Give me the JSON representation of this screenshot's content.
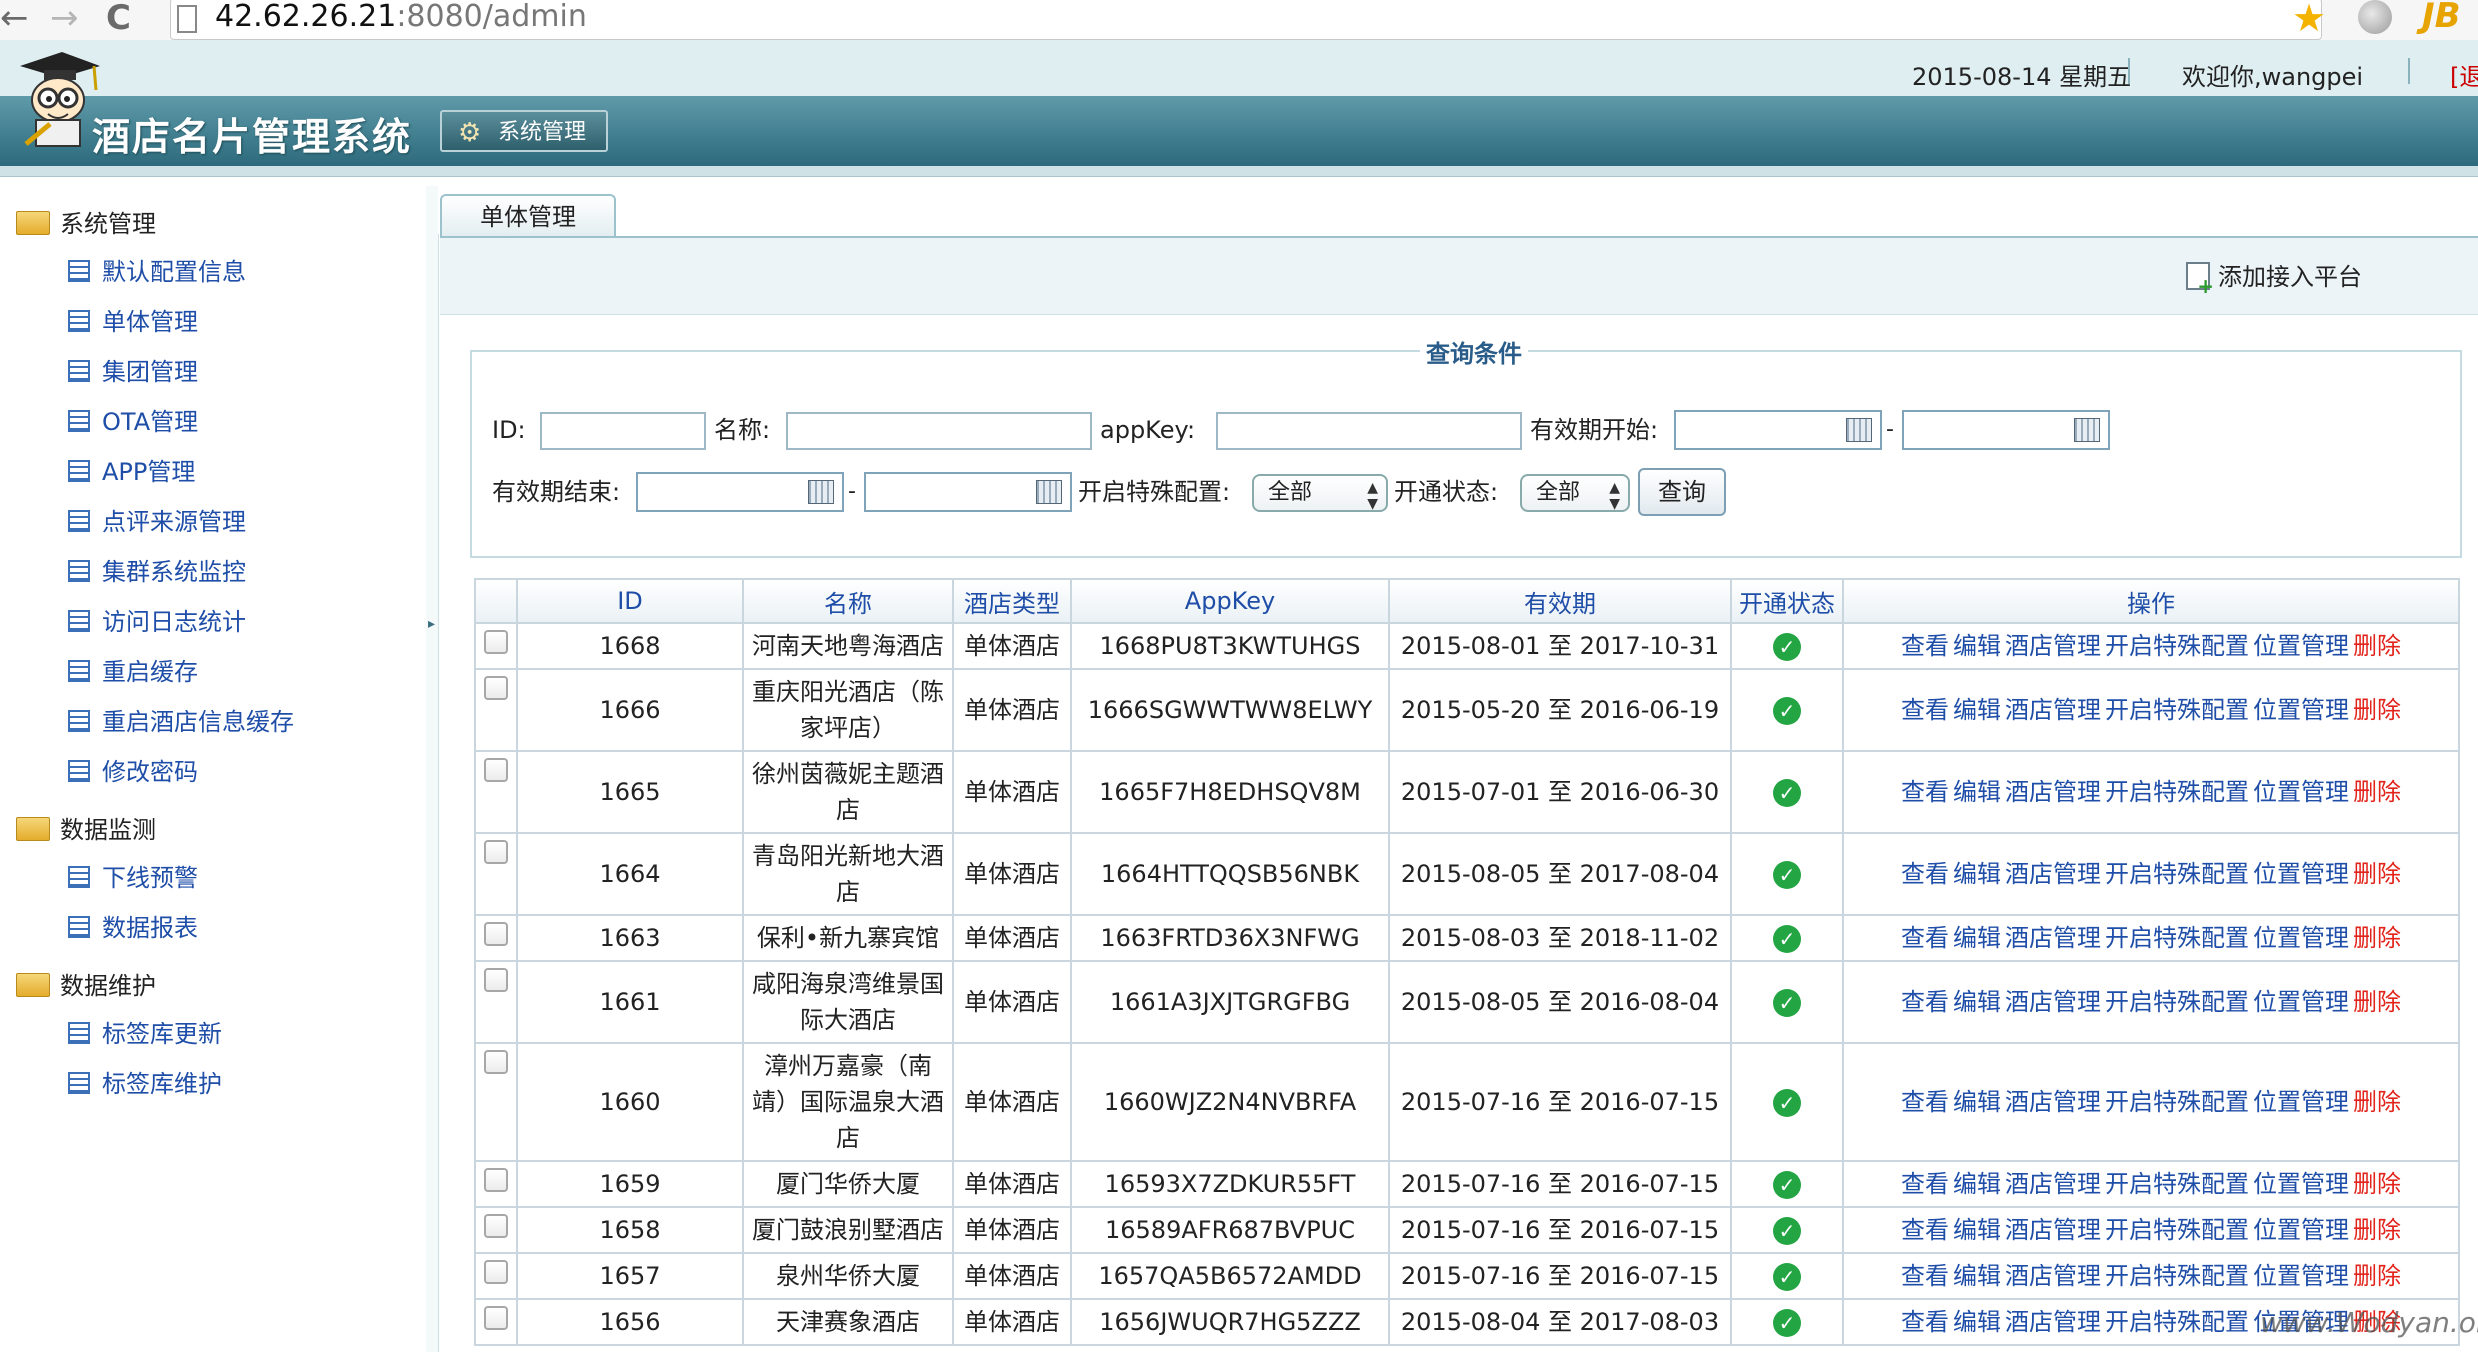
{
  "browser": {
    "url_host": "42.62.26.21",
    "url_path": ":8080/admin",
    "back_glyph": "←",
    "forward_glyph": "→",
    "reload_glyph": "C",
    "star_glyph": "★",
    "jb_text": "JB"
  },
  "header": {
    "date": "2015-08-14 星期五",
    "welcome": "欢迎你,wangpei",
    "logout": "[退",
    "app_title": "酒店名片管理系统",
    "tab_label": "系统管理",
    "gear_glyph": "⚙"
  },
  "sidebar": {
    "groups": [
      {
        "label": "系统管理",
        "items": [
          "默认配置信息",
          "单体管理",
          "集团管理",
          "OTA管理",
          "APP管理",
          "点评来源管理",
          "集群系统监控",
          "访问日志统计",
          "重启缓存",
          "重启酒店信息缓存",
          "修改密码"
        ]
      },
      {
        "label": "数据监测",
        "items": [
          "下线预警",
          "数据报表"
        ]
      },
      {
        "label": "数据维护",
        "items": [
          "标签库更新",
          "标签库维护"
        ]
      }
    ],
    "collapse_glyph": "▸"
  },
  "main": {
    "tab": "单体管理",
    "add_label": "添加接入平台",
    "query": {
      "title": "查询条件",
      "id_label": "ID:",
      "name_label": "名称:",
      "appkey_label": "appKey:",
      "valid_start_label": "有效期开始:",
      "valid_end_label": "有效期结束:",
      "special_label": "开启特殊配置:",
      "status_label": "开通状态:",
      "special_value": "全部",
      "status_value": "全部",
      "dash": "-",
      "search_label": "查询",
      "arrow_glyph": "▲▼"
    },
    "table": {
      "headers": [
        "ID",
        "名称",
        "酒店类型",
        "AppKey",
        "有效期",
        "开通状态",
        "操作"
      ],
      "ops": [
        "查看",
        "编辑",
        "酒店管理",
        "开启特殊配置",
        "位置管理",
        "删除"
      ],
      "status_glyph": "✓",
      "rows": [
        {
          "id": "1668",
          "name": "河南天地粤海酒店",
          "type": "单体酒店",
          "appkey": "1668PU8T3KWTUHGS",
          "valid": "2015-08-01 至 2017-10-31"
        },
        {
          "id": "1666",
          "name": "重庆阳光酒店（陈家坪店）",
          "type": "单体酒店",
          "appkey": "1666SGWWTWW8ELWY",
          "valid": "2015-05-20 至 2016-06-19"
        },
        {
          "id": "1665",
          "name": "徐州茵薇妮主题酒店",
          "type": "单体酒店",
          "appkey": "1665F7H8EDHSQV8M",
          "valid": "2015-07-01 至 2016-06-30"
        },
        {
          "id": "1664",
          "name": "青岛阳光新地大酒店",
          "type": "单体酒店",
          "appkey": "1664HTTQQSB56NBK",
          "valid": "2015-08-05 至 2017-08-04"
        },
        {
          "id": "1663",
          "name": "保利•新九寨宾馆",
          "type": "单体酒店",
          "appkey": "1663FRTD36X3NFWG",
          "valid": "2015-08-03 至 2018-11-02"
        },
        {
          "id": "1661",
          "name": "咸阳海泉湾维景国际大酒店",
          "type": "单体酒店",
          "appkey": "1661A3JXJTGRGFBG",
          "valid": "2015-08-05 至 2016-08-04"
        },
        {
          "id": "1660",
          "name": "漳州万嘉豪（南靖）国际温泉大酒店",
          "type": "单体酒店",
          "appkey": "1660WJZ2N4NVBRFA",
          "valid": "2015-07-16 至 2016-07-15"
        },
        {
          "id": "1659",
          "name": "厦门华侨大厦",
          "type": "单体酒店",
          "appkey": "16593X7ZDKUR55FT",
          "valid": "2015-07-16 至 2016-07-15"
        },
        {
          "id": "1658",
          "name": "厦门鼓浪别墅酒店",
          "type": "单体酒店",
          "appkey": "16589AFR687BVPUC",
          "valid": "2015-07-16 至 2016-07-15"
        },
        {
          "id": "1657",
          "name": "泉州华侨大厦",
          "type": "单体酒店",
          "appkey": "1657QA5B6572AMDD",
          "valid": "2015-07-16 至 2016-07-15"
        },
        {
          "id": "1656",
          "name": "天津赛象酒店",
          "type": "单体酒店",
          "appkey": "1656JWUQR7HG5ZZZ",
          "valid": "2015-08-04 至 2017-08-03"
        }
      ]
    }
  },
  "watermark": "www.Wodyan.org",
  "colors": {
    "link": "#1f4ea8",
    "delete": "#e2231a",
    "ok": "#22a542",
    "header_dark": "#2d6b7c"
  }
}
